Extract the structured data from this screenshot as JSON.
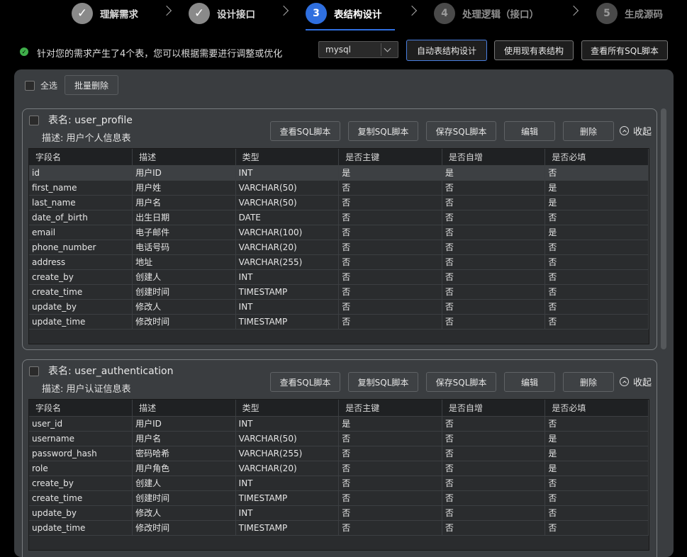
{
  "steps": [
    {
      "label": "理解需求",
      "state": "done",
      "marker": "✓"
    },
    {
      "label": "设计接口",
      "state": "done",
      "marker": "✓"
    },
    {
      "label": "表结构设计",
      "state": "active",
      "marker": "3"
    },
    {
      "label": "处理逻辑（接口）",
      "state": "todo",
      "marker": "4"
    },
    {
      "label": "生成源码",
      "state": "todo",
      "marker": "5"
    }
  ],
  "info": {
    "message": "针对您的需求产生了4个表，您可以根据需要进行调整或优化",
    "db_select": "mysql",
    "btn_auto": "自动表结构设计",
    "btn_use_existing": "使用现有表结构",
    "btn_view_all": "查看所有SQL脚本"
  },
  "toolbar": {
    "select_all": "全选",
    "batch_delete": "批量删除"
  },
  "columns": [
    "字段名",
    "描述",
    "类型",
    "是否主键",
    "是否自增",
    "是否必填"
  ],
  "actions": {
    "view_sql": "查看SQL脚本",
    "copy_sql": "复制SQL脚本",
    "save_sql": "保存SQL脚本",
    "edit": "编辑",
    "delete": "删除",
    "collapse": "收起"
  },
  "tables": [
    {
      "name": "表名: user_profile",
      "desc": "描述: 用户个人信息表",
      "rows": [
        [
          "id",
          "用户ID",
          "INT",
          "是",
          "是",
          "否"
        ],
        [
          "first_name",
          "用户姓",
          "VARCHAR(50)",
          "否",
          "否",
          "是"
        ],
        [
          "last_name",
          "用户名",
          "VARCHAR(50)",
          "否",
          "否",
          "是"
        ],
        [
          "date_of_birth",
          "出生日期",
          "DATE",
          "否",
          "否",
          "否"
        ],
        [
          "email",
          "电子邮件",
          "VARCHAR(100)",
          "否",
          "否",
          "是"
        ],
        [
          "phone_number",
          "电话号码",
          "VARCHAR(20)",
          "否",
          "否",
          "否"
        ],
        [
          "address",
          "地址",
          "VARCHAR(255)",
          "否",
          "否",
          "否"
        ],
        [
          "create_by",
          "创建人",
          "INT",
          "否",
          "否",
          "否"
        ],
        [
          "create_time",
          "创建时间",
          "TIMESTAMP",
          "否",
          "否",
          "否"
        ],
        [
          "update_by",
          "修改人",
          "INT",
          "否",
          "否",
          "否"
        ],
        [
          "update_time",
          "修改时间",
          "TIMESTAMP",
          "否",
          "否",
          "否"
        ]
      ]
    },
    {
      "name": "表名: user_authentication",
      "desc": "描述: 用户认证信息表",
      "rows": [
        [
          "user_id",
          "用户ID",
          "INT",
          "是",
          "否",
          "否"
        ],
        [
          "username",
          "用户名",
          "VARCHAR(50)",
          "否",
          "否",
          "是"
        ],
        [
          "password_hash",
          "密码哈希",
          "VARCHAR(255)",
          "否",
          "否",
          "是"
        ],
        [
          "role",
          "用户角色",
          "VARCHAR(20)",
          "否",
          "否",
          "是"
        ],
        [
          "create_by",
          "创建人",
          "INT",
          "否",
          "否",
          "否"
        ],
        [
          "create_time",
          "创建时间",
          "TIMESTAMP",
          "否",
          "否",
          "否"
        ],
        [
          "update_by",
          "修改人",
          "INT",
          "否",
          "否",
          "否"
        ],
        [
          "update_time",
          "修改时间",
          "TIMESTAMP",
          "否",
          "否",
          "否"
        ]
      ]
    }
  ]
}
